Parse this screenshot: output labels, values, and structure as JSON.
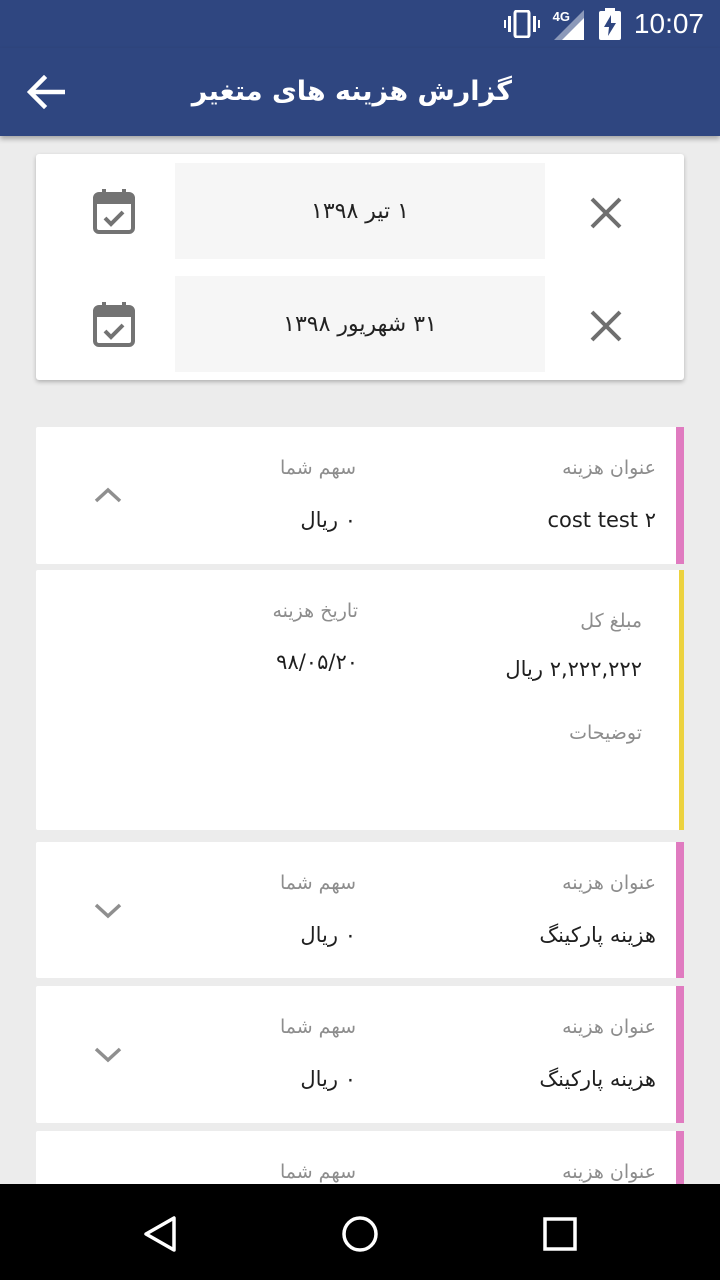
{
  "status_bar": {
    "time": "10:07",
    "network": "4G",
    "icons": [
      "vibrate-icon",
      "signal-icon",
      "battery-charging-icon"
    ]
  },
  "app_bar": {
    "title": "گزارش هزینه های متغیر",
    "back_icon": "arrow-back-icon"
  },
  "date_filter": {
    "from_date": "۱ تیر ۱۳۹۸",
    "to_date": "۳۱ شهریور ۱۳۹۸",
    "calendar_icon": "calendar-check-icon",
    "clear_icon": "close-icon"
  },
  "expenses": [
    {
      "title_label": "عنوان هزینه",
      "title": "cost test ۲",
      "share_label": "سهم شما",
      "share": "۰ ریال",
      "expanded": true,
      "stripe_color": "#e07bc0",
      "details": {
        "total_label": "مبلغ کل",
        "total": "۲,۲۲۲,۲۲۲ ریال",
        "date_label": "تاریخ هزینه",
        "date": "۹۸/۰۵/۲۰",
        "notes_label": "توضیحات",
        "stripe_color": "#ecd23e"
      }
    },
    {
      "title_label": "عنوان هزینه",
      "title": "هزینه پارکینگ",
      "share_label": "سهم شما",
      "share": "۰ ریال",
      "expanded": false,
      "stripe_color": "#e07bc0"
    },
    {
      "title_label": "عنوان هزینه",
      "title": "هزینه پارکینگ",
      "share_label": "سهم شما",
      "share": "۰ ریال",
      "expanded": false,
      "stripe_color": "#e07bc0"
    },
    {
      "title_label": "عنوان هزینه",
      "share_label": "سهم شما",
      "stripe_color": "#e07bc0"
    }
  ],
  "nav_bar": {
    "icons": [
      "nav-back-icon",
      "nav-home-icon",
      "nav-recents-icon"
    ]
  }
}
